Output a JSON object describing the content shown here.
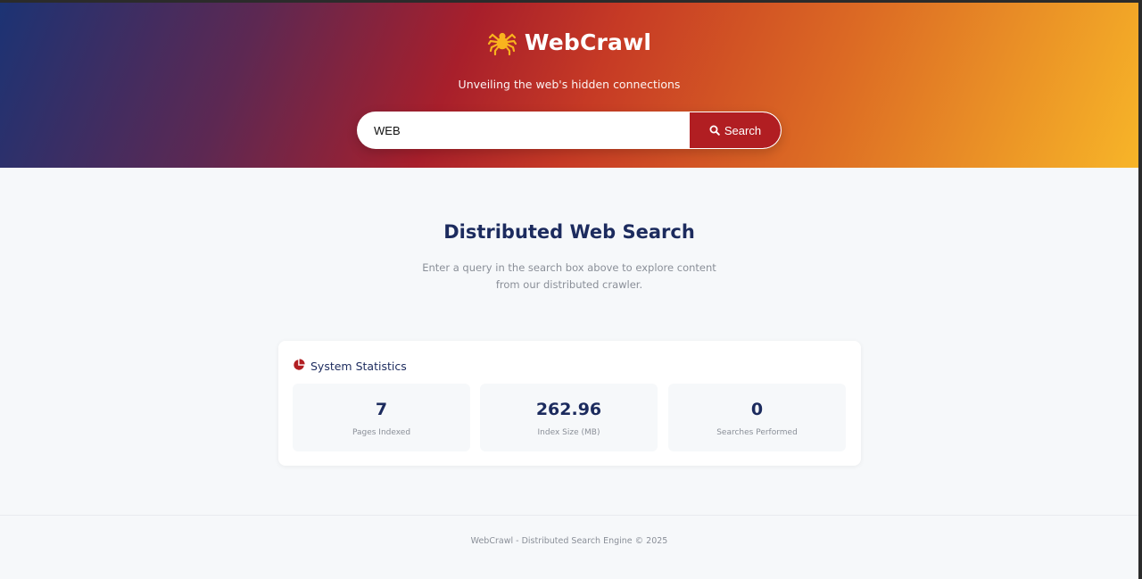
{
  "header": {
    "brand_icon": "spider-icon",
    "title": "WebCrawl",
    "tagline": "Unveiling the web's hidden connections"
  },
  "search": {
    "value": "WEB",
    "button_label": "Search",
    "button_icon": "search-icon"
  },
  "main": {
    "title": "Distributed Web Search",
    "description": "Enter a query in the search box above to explore content from our distributed crawler."
  },
  "stats": {
    "icon": "pie-chart-icon",
    "title": "System Statistics",
    "items": [
      {
        "value": "7",
        "label": "Pages Indexed"
      },
      {
        "value": "262.96",
        "label": "Index Size (MB)"
      },
      {
        "value": "0",
        "label": "Searches Performed"
      }
    ]
  },
  "footer": {
    "text": "WebCrawl - Distributed Search Engine © 2025"
  },
  "colors": {
    "accent": "#b11e22",
    "heading": "#1c2b5e",
    "muted": "#8a8f98",
    "background": "#f6f8fa"
  }
}
